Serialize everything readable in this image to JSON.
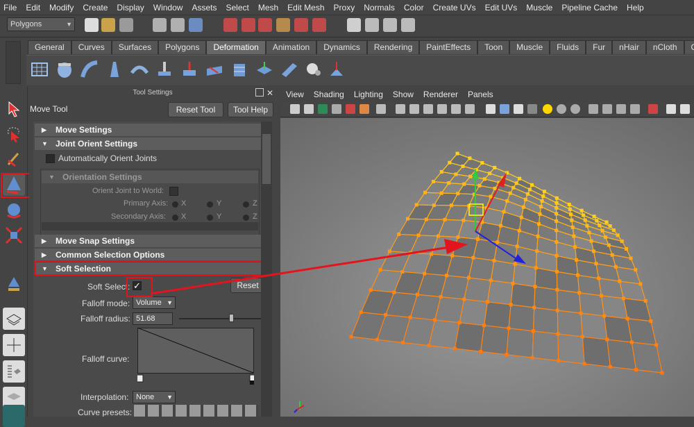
{
  "menu": [
    "File",
    "Edit",
    "Modify",
    "Create",
    "Display",
    "Window",
    "Assets",
    "Select",
    "Mesh",
    "Edit Mesh",
    "Proxy",
    "Normals",
    "Color",
    "Create UVs",
    "Edit UVs",
    "Muscle",
    "Pipeline Cache",
    "Help"
  ],
  "status": {
    "mode_select": "Polygons"
  },
  "shelf": {
    "tabs": [
      "General",
      "Curves",
      "Surfaces",
      "Polygons",
      "Deformation",
      "Animation",
      "Dynamics",
      "Rendering",
      "PaintEffects",
      "Toon",
      "Muscle",
      "Fluids",
      "Fur",
      "nHair",
      "nCloth",
      "Custom"
    ],
    "active_tab": "Deformation"
  },
  "tool_settings": {
    "title": "Tool Settings",
    "tool_name": "Move Tool",
    "reset_tool": "Reset Tool",
    "tool_help": "Tool Help",
    "sections": {
      "move": "Move Settings",
      "joint": "Joint Orient Settings",
      "auto_orient": "Automatically Orient Joints",
      "orientation": "Orientation Settings",
      "orient_world": "Orient Joint to World:",
      "primary": "Primary Axis:",
      "secondary": "Secondary Axis:",
      "axis_x": "X",
      "axis_y": "Y",
      "axis_z": "Z",
      "snap": "Move Snap Settings",
      "common": "Common Selection Options",
      "soft": "Soft Selection"
    },
    "soft_select_label": "Soft Select:",
    "soft_select_checked": "✓",
    "reset": "Reset",
    "falloff_mode_label": "Falloff mode:",
    "falloff_mode": "Volume",
    "falloff_radius_label": "Falloff radius:",
    "falloff_radius": "51.68",
    "falloff_curve_label": "Falloff curve:",
    "interpolation_label": "Interpolation:",
    "interpolation": "None",
    "curve_presets_label": "Curve presets:"
  },
  "viewport": {
    "menu": [
      "View",
      "Shading",
      "Lighting",
      "Show",
      "Renderer",
      "Panels"
    ]
  },
  "colors": {
    "highlight": "#e4141c",
    "mesh_near": "#ff7a10",
    "mesh_far": "#ffd020"
  }
}
